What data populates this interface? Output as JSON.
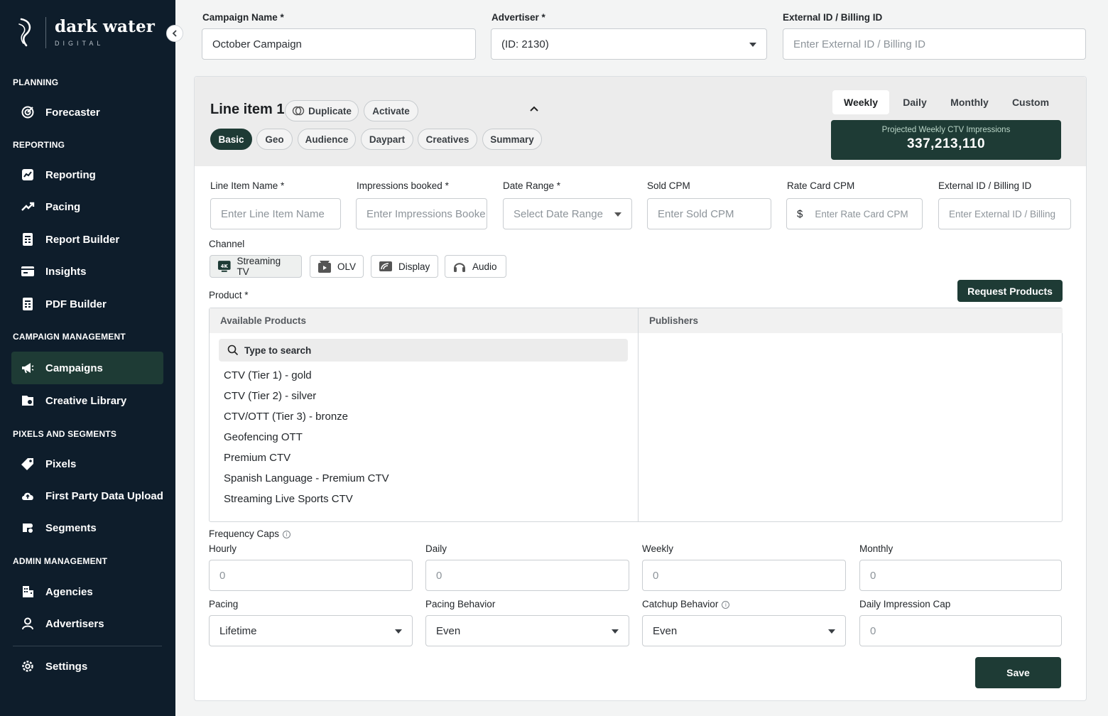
{
  "sidebar": {
    "logo": {
      "name": "dark water",
      "sub": "DIGITAL"
    },
    "sections": {
      "planning": "PLANNING",
      "reporting": "REPORTING",
      "campaign_management": "CAMPAIGN MANAGEMENT",
      "pixels_segments": "PIXELS AND SEGMENTS",
      "admin": "ADMIN MANAGEMENT"
    },
    "items": {
      "forecaster": "Forecaster",
      "reporting": "Reporting",
      "pacing": "Pacing",
      "report_builder": "Report Builder",
      "insights": "Insights",
      "pdf_builder": "PDF Builder",
      "campaigns": "Campaigns",
      "creative_library": "Creative Library",
      "pixels": "Pixels",
      "first_party": "First Party Data Upload",
      "segments": "Segments",
      "agencies": "Agencies",
      "advertisers": "Advertisers",
      "settings": "Settings"
    }
  },
  "campaign": {
    "name_label": "Campaign Name *",
    "name_value": "October Campaign",
    "advertiser_label": "Advertiser *",
    "advertiser_value": "(ID: 2130)",
    "external_label": "External ID / Billing ID",
    "external_placeholder": "Enter External ID / Billing ID"
  },
  "line_item": {
    "title": "Line item 1",
    "duplicate": "Duplicate",
    "activate": "Activate",
    "tabs": [
      "Basic",
      "Geo",
      "Audience",
      "Daypart",
      "Creatives",
      "Summary"
    ],
    "period_tabs": [
      "Weekly",
      "Daily",
      "Monthly",
      "Custom"
    ],
    "projected_label": "Projected Weekly CTV Impressions",
    "projected_value": "337,213,110",
    "fields": {
      "name_label": "Line Item Name *",
      "name_placeholder": "Enter Line Item Name",
      "impressions_label": "Impressions booked *",
      "impressions_placeholder": "Enter Impressions Booke",
      "date_label": "Date Range *",
      "date_placeholder": "Select Date Range",
      "sold_cpm_label": "Sold CPM",
      "sold_cpm_placeholder": "Enter Sold CPM",
      "rate_card_label": "Rate Card CPM",
      "rate_card_prefix": "$",
      "rate_card_placeholder": "Enter Rate Card CPM",
      "external_label": "External ID / Billing ID",
      "external_placeholder": "Enter External ID / Billing"
    },
    "channel_label": "Channel",
    "channels": [
      "Streaming TV",
      "OLV",
      "Display",
      "Audio"
    ],
    "product_label": "Product *",
    "request_products": "Request Products",
    "available_products_header": "Available Products",
    "publishers_header": "Publishers",
    "search_placeholder": "Type to search",
    "products": [
      "CTV (Tier 1) - gold",
      "CTV (Tier 2) - silver",
      "CTV/OTT (Tier 3) - bronze",
      "Geofencing OTT",
      "Premium CTV",
      "Spanish Language - Premium CTV",
      "Streaming Live Sports CTV"
    ],
    "frequency_caps_label": "Frequency Caps",
    "caps": {
      "hourly_label": "Hourly",
      "hourly_value": "0",
      "daily_label": "Daily",
      "daily_value": "0",
      "weekly_label": "Weekly",
      "weekly_value": "0",
      "monthly_label": "Monthly",
      "monthly_value": "0"
    },
    "pacing_label": "Pacing",
    "pacing_value": "Lifetime",
    "pacing_behavior_label": "Pacing Behavior",
    "pacing_behavior_value": "Even",
    "catchup_label": "Catchup Behavior",
    "catchup_value": "Even",
    "daily_cap_label": "Daily Impression Cap",
    "daily_cap_value": "0",
    "save": "Save"
  }
}
